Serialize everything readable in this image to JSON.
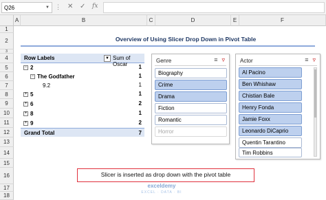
{
  "formula_bar": {
    "name_box": "Q26",
    "dots": "⋮",
    "cancel_glyph": "✕",
    "enter_glyph": "✓",
    "fx_glyph": "fx",
    "formula_value": ""
  },
  "columns": [
    "A",
    "B",
    "C",
    "D",
    "E",
    "F"
  ],
  "rows": [
    "1",
    "2",
    "3",
    "4",
    "5",
    "6",
    "7",
    "8",
    "9",
    "10",
    "11",
    "12",
    "13",
    "14",
    "15",
    "16",
    "17",
    "18"
  ],
  "title": "Overview of Using Slicer Drop Down in Pivot Table",
  "pivot": {
    "header_label": "Row Labels",
    "header_value": "Sum of Oscar",
    "rows": [
      {
        "expander": "−",
        "label": "2",
        "value": "1"
      },
      {
        "expander": "−",
        "label": "The Godfather",
        "value": "1"
      },
      {
        "expander": "",
        "label": "9.2",
        "value": "1"
      },
      {
        "expander": "+",
        "label": "5",
        "value": "1"
      },
      {
        "expander": "+",
        "label": "6",
        "value": "2"
      },
      {
        "expander": "+",
        "label": "8",
        "value": "1"
      },
      {
        "expander": "+",
        "label": "9",
        "value": "2"
      }
    ],
    "total_label": "Grand Total",
    "total_value": "7"
  },
  "genre_slicer": {
    "title": "Genre",
    "items": [
      {
        "label": "Biography",
        "state": "normal"
      },
      {
        "label": "Crime",
        "state": "selected"
      },
      {
        "label": "Drama",
        "state": "selected"
      },
      {
        "label": "Fiction",
        "state": "normal"
      },
      {
        "label": "Romantic",
        "state": "normal"
      },
      {
        "label": "Horror",
        "state": "dim"
      }
    ]
  },
  "actor_slicer": {
    "title": "Actor",
    "items": [
      {
        "label": "Al Pacino",
        "state": "selected"
      },
      {
        "label": "Ben Whishaw",
        "state": "selected"
      },
      {
        "label": "Chistian Bale",
        "state": "selected"
      },
      {
        "label": "Henry Fonda",
        "state": "selected"
      },
      {
        "label": "Jamie Foxx",
        "state": "selected"
      },
      {
        "label": "Leonardo DiCaprio",
        "state": "selected"
      },
      {
        "label": "Quentin Tarantino",
        "state": "normal"
      },
      {
        "label": "Tim Robbins",
        "state": "normal"
      }
    ]
  },
  "callout": "Slicer is inserted as drop down with the pivot table",
  "watermark": {
    "name": "exceldemy",
    "tagline": "EXCEL · DATA · BI"
  },
  "icons": {
    "multiselect": "multi-select-icon",
    "clear_filter": "clear-filter-icon"
  }
}
